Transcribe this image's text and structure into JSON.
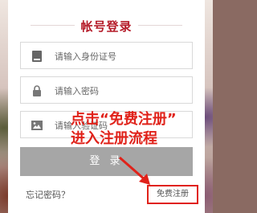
{
  "login": {
    "title": "帐号登录",
    "id_placeholder": "请输入身份证号",
    "password_placeholder": "请输入密码",
    "captcha_placeholder": "请输入验证码",
    "login_label": "登 录",
    "forgot_label": "忘记密码？",
    "register_label": "免费注册"
  },
  "annotation": {
    "line1": "点击“免费注册”",
    "line2": "进入注册流程"
  },
  "colors": {
    "title": "#b51c2a",
    "annotation": "#e0221a",
    "login_button": "#a6a6a6"
  },
  "icons": {
    "id": "id-card-icon",
    "password": "lock-icon",
    "captcha": "image-icon",
    "arrow": "arrow-icon"
  }
}
